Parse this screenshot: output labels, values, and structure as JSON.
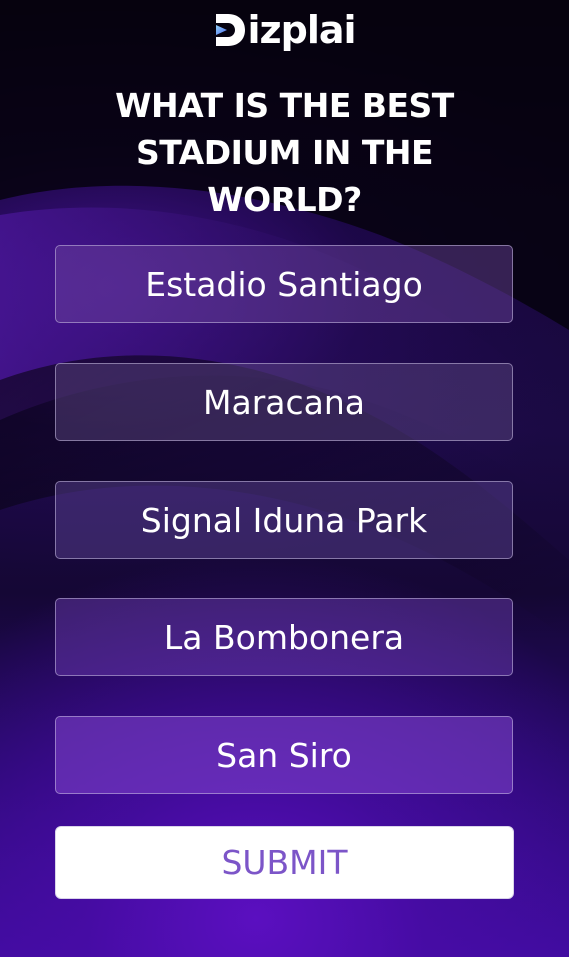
{
  "brand": {
    "name": "Dizplai",
    "logo_text": "izplai",
    "colors": {
      "logo_mark_light": "#8fd0f5",
      "logo_mark_dark": "#4f6df0"
    }
  },
  "poll": {
    "question": "WHAT IS THE BEST STADIUM IN THE WORLD?",
    "options": [
      {
        "label": "Estadio Santiago"
      },
      {
        "label": "Maracana"
      },
      {
        "label": "Signal Iduna Park"
      },
      {
        "label": "La Bombonera"
      },
      {
        "label": "San Siro"
      }
    ],
    "submit_label": "SUBMIT"
  },
  "colors": {
    "background_top": "#07030f",
    "background_bottom": "#3d0c9e",
    "submit_text": "#7c55c8",
    "submit_background": "#ffffff"
  }
}
